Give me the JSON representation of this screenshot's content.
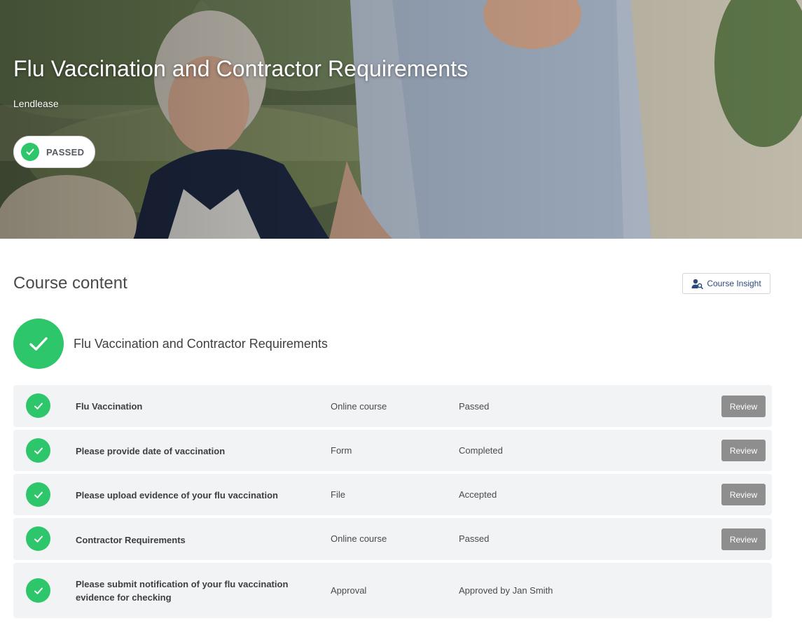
{
  "hero": {
    "title": "Flu Vaccination and Contractor Requirements",
    "organisation": "Lendlease",
    "status_label": "PASSED",
    "status_icon": "check-icon"
  },
  "content": {
    "section_title": "Course content",
    "insight_button_label": "Course Insight",
    "insight_icon": "user-search-icon",
    "course_name": "Flu Vaccination and Contractor Requirements",
    "items": [
      {
        "name": "Flu Vaccination",
        "type": "Online course",
        "status": "Passed",
        "action": "Review"
      },
      {
        "name": "Please provide date of vaccination",
        "type": "Form",
        "status": "Completed",
        "action": "Review"
      },
      {
        "name": "Please upload evidence of your flu vaccination",
        "type": "File",
        "status": "Accepted",
        "action": "Review"
      },
      {
        "name": "Contractor Requirements",
        "type": "Online course",
        "status": "Passed",
        "action": "Review"
      },
      {
        "name": "Please submit notification of your flu vaccination evidence for checking",
        "type": "Approval",
        "status": "Approved by Jan Smith",
        "action": ""
      }
    ]
  },
  "colors": {
    "success_green": "#2ec66b",
    "review_button": "#8e8e8e",
    "row_background": "#f2f3f5",
    "link_blue": "#2b4a7a"
  }
}
